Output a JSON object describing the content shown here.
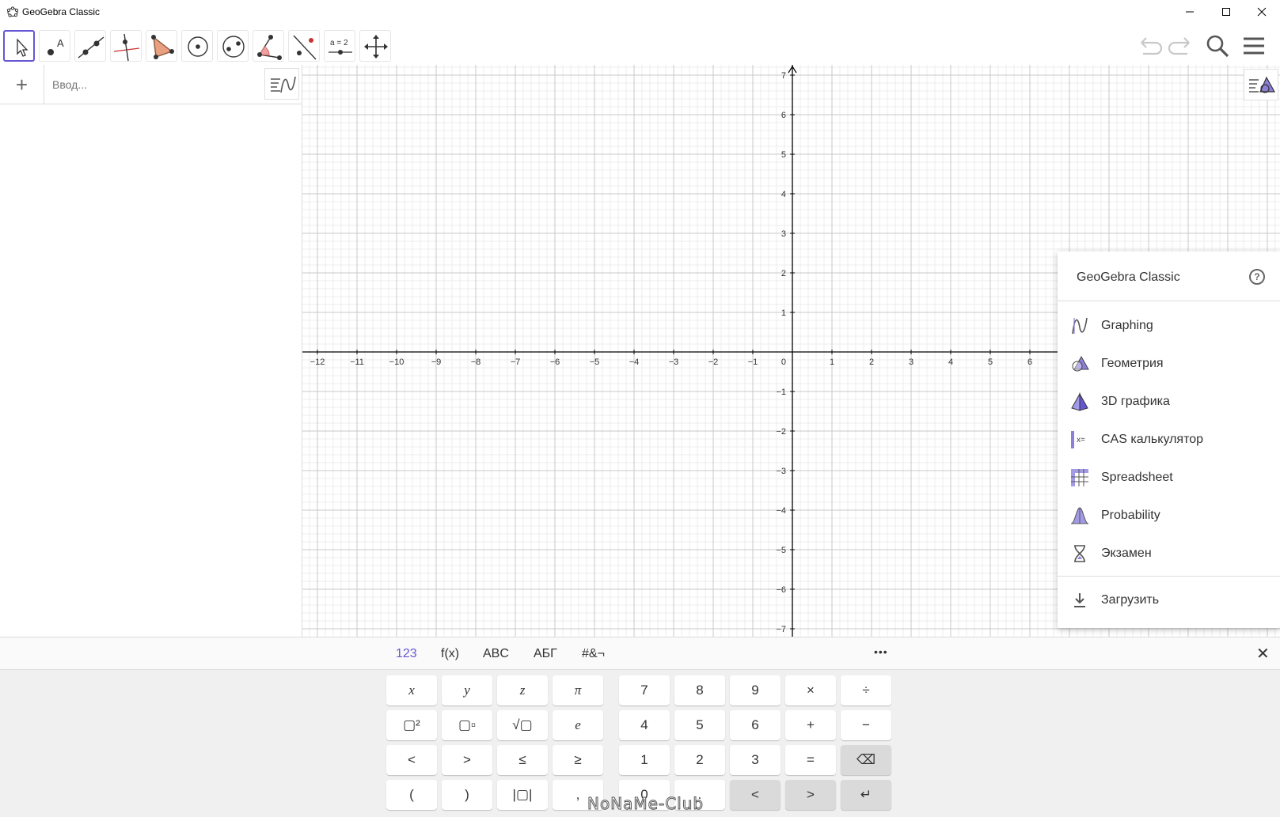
{
  "window": {
    "title": "GeoGebra Classic"
  },
  "toolbar": {
    "tools": [
      {
        "name": "move-tool",
        "icon": "move-arrow-icon"
      },
      {
        "name": "point-tool",
        "icon": "point-icon"
      },
      {
        "name": "line-tool",
        "icon": "line-icon"
      },
      {
        "name": "perpendicular-tool",
        "icon": "perpendicular-icon"
      },
      {
        "name": "polygon-tool",
        "icon": "polygon-icon"
      },
      {
        "name": "circle-tool",
        "icon": "circle-icon"
      },
      {
        "name": "ellipse-tool",
        "icon": "ellipse-icon"
      },
      {
        "name": "angle-tool",
        "icon": "angle-icon"
      },
      {
        "name": "reflect-tool",
        "icon": "reflect-icon"
      },
      {
        "name": "slider-tool",
        "icon": "slider-icon",
        "text": "a = 2"
      },
      {
        "name": "move-view-tool",
        "icon": "move-view-icon"
      }
    ]
  },
  "algebra": {
    "input_placeholder": "Ввод..."
  },
  "graphics": {
    "x_ticks": [
      "-12",
      "-11",
      "-10",
      "-9",
      "-8",
      "-7",
      "-6",
      "-5",
      "-4",
      "-3",
      "-2",
      "-1",
      "0",
      "1",
      "2",
      "3",
      "4",
      "5",
      "6"
    ],
    "y_ticks": [
      "7",
      "6",
      "5",
      "4",
      "3",
      "2",
      "1",
      "-1",
      "-2",
      "-3",
      "-4",
      "-5",
      "-6",
      "-7"
    ],
    "axis_color": "#000000",
    "grid_major_color": "#c8c8c8",
    "grid_minor_color": "#ececec"
  },
  "perspectives": {
    "header": "GeoGebra Classic",
    "help": "?",
    "items": [
      {
        "label": "Graphing",
        "icon": "graphing-icon"
      },
      {
        "label": "Геометрия",
        "icon": "geometry-icon"
      },
      {
        "label": "3D графика",
        "icon": "3d-graphics-icon"
      },
      {
        "label": "CAS калькулятор",
        "icon": "cas-icon"
      },
      {
        "label": "Spreadsheet",
        "icon": "spreadsheet-icon"
      },
      {
        "label": "Probability",
        "icon": "probability-icon"
      },
      {
        "label": "Экзамен",
        "icon": "exam-icon"
      }
    ],
    "download": {
      "label": "Загрузить",
      "icon": "download-icon"
    }
  },
  "keyboard": {
    "tabs": [
      "123",
      "f(x)",
      "ABC",
      "АБГ",
      "#&¬"
    ],
    "active_tab": "123",
    "more": "•••",
    "close": "✕",
    "left_keys": [
      [
        "x",
        "y",
        "z",
        "π"
      ],
      [
        "▢²",
        "▢▫",
        "√▢",
        "e"
      ],
      [
        "<",
        ">",
        "≤",
        "≥"
      ],
      [
        "(",
        ")",
        "|▢|",
        ","
      ]
    ],
    "right_keys": [
      [
        "7",
        "8",
        "9",
        "×",
        "÷"
      ],
      [
        "4",
        "5",
        "6",
        "+",
        "−"
      ],
      [
        "1",
        "2",
        "3",
        "=",
        "⌫"
      ],
      [
        "0",
        ".",
        "<",
        ">",
        "↵"
      ]
    ]
  },
  "watermark": "NoNaMe-Club",
  "colors": {
    "accent": "#6557d2",
    "icon_purple": "#8c7fd8"
  }
}
